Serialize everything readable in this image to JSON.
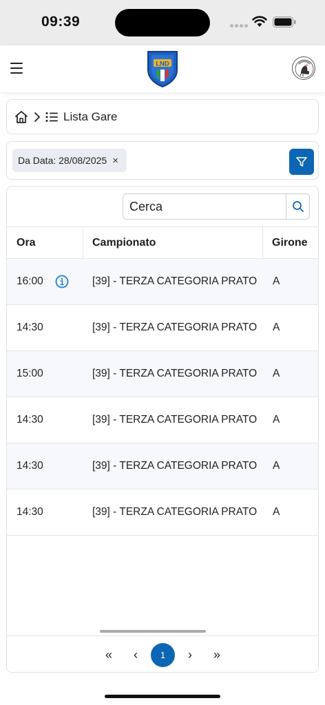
{
  "status_bar": {
    "time": "09:39"
  },
  "header": {
    "logo_text": "LND"
  },
  "breadcrumb": {
    "label": "Lista Gare"
  },
  "filter": {
    "chip_text": "Da Data: 28/08/2025",
    "chip_close": "×"
  },
  "search": {
    "placeholder": "Cerca"
  },
  "table": {
    "columns": {
      "ora": "Ora",
      "campionato": "Campionato",
      "girone": "Girone"
    },
    "rows": [
      {
        "ora": "16:00",
        "campionato": "[39] - TERZA CATEGORIA PRATO",
        "girone": "A",
        "info": true
      },
      {
        "ora": "14:30",
        "campionato": "[39] - TERZA CATEGORIA PRATO",
        "girone": "A"
      },
      {
        "ora": "15:00",
        "campionato": "[39] - TERZA CATEGORIA PRATO",
        "girone": "A"
      },
      {
        "ora": "14:30",
        "campionato": "[39] - TERZA CATEGORIA PRATO",
        "girone": "A"
      },
      {
        "ora": "14:30",
        "campionato": "[39] - TERZA CATEGORIA PRATO",
        "girone": "A"
      },
      {
        "ora": "14:30",
        "campionato": "[39] - TERZA CATEGORIA PRATO",
        "girone": "A"
      }
    ]
  },
  "pagination": {
    "first": "«",
    "prev": "‹",
    "current": "1",
    "next": "›",
    "last": "»"
  },
  "colors": {
    "accent": "#0d66b3",
    "row_alt": "#f6f8fb",
    "border": "#e3e6ea"
  }
}
